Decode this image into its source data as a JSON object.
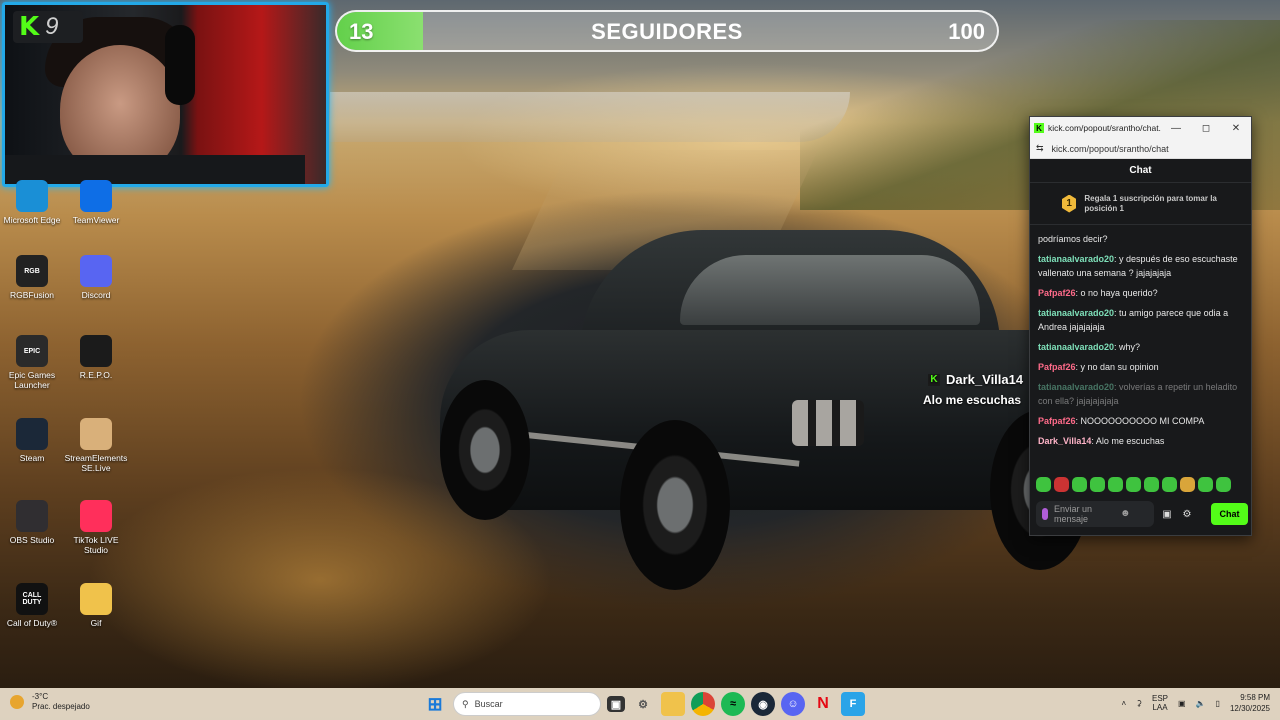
{
  "webcam": {
    "logo_letter": "K",
    "logo_number": "9"
  },
  "follower_goal": {
    "current": "13",
    "title": "SEGUIDORES",
    "goal": "100",
    "progress_fraction": 0.13
  },
  "desktop_icons": [
    {
      "label": "Microsoft Edge",
      "icon": "edge-icon",
      "color": "#1a8fd6"
    },
    {
      "label": "TeamViewer",
      "icon": "teamviewer-icon",
      "color": "#0e6ee6"
    },
    {
      "label": "RGBFusion",
      "icon": "rgbfusion-icon",
      "color": "#222222",
      "glyph": "RGB"
    },
    {
      "label": "Discord",
      "icon": "discord-icon",
      "color": "#5865f2"
    },
    {
      "label": "Epic Games Launcher",
      "icon": "epic-games-icon",
      "color": "#2a2a2a",
      "glyph": "EPIC"
    },
    {
      "label": "R.E.P.O.",
      "icon": "repo-icon",
      "color": "#1b1b1b"
    },
    {
      "label": "Steam",
      "icon": "steam-icon",
      "color": "#1b2838"
    },
    {
      "label": "StreamElements SE.Live",
      "icon": "streamelements-icon",
      "color": "#d9b07a"
    },
    {
      "label": "OBS Studio",
      "icon": "obs-icon",
      "color": "#302e31"
    },
    {
      "label": "TikTok LIVE Studio",
      "icon": "tiktok-icon",
      "color": "#ff2f5b"
    },
    {
      "label": "Call of Duty®",
      "icon": "call-of-duty-icon",
      "color": "#111111",
      "glyph": "CALL DUTY"
    },
    {
      "label": "Gif",
      "icon": "folder-icon",
      "color": "#f0c24b"
    }
  ],
  "overlay": {
    "badge": "K",
    "username": "Dark_Villa14",
    "message": "Alo me escuchas"
  },
  "chat_window": {
    "tab_title": "kick.com/popout/srantho/chat...",
    "url": "kick.com/popout/srantho/chat",
    "header": "Chat",
    "sub_rank": "1",
    "sub_text": "Regala 1 suscripción para tomar la posición 1",
    "messages": [
      {
        "user": "",
        "text": "podríamos decir?",
        "color": "#7ee0b9",
        "dim": false
      },
      {
        "user": "tatianaalvarado20",
        "text": ": y después de eso escuchaste vallenato una semana ? jajajajaja",
        "color": "#7ee0b9",
        "dim": false
      },
      {
        "user": "Pafpaf26",
        "text": ": o no haya querido?",
        "color": "#ff6b8a",
        "dim": false
      },
      {
        "user": "tatianaalvarado20",
        "text": ": tu amigo parece que odia a Andrea jajajajaja",
        "color": "#7ee0b9",
        "dim": false
      },
      {
        "user": "tatianaalvarado20",
        "text": ": why?",
        "color": "#7ee0b9",
        "dim": false
      },
      {
        "user": "Pafpaf26",
        "text": ": y no dan su opinion",
        "color": "#ff6b8a",
        "dim": false
      },
      {
        "user": "tatianaalvarado20",
        "text": ": volverías a repetir un heladito con ella? jajajajajaja",
        "color": "#7ee0b9",
        "dim": true
      },
      {
        "user": "Pafpaf26",
        "text": ": NOOOOOOOOOO MI COMPA",
        "color": "#ff6b8a",
        "dim": false
      },
      {
        "user": "Dark_Villa14",
        "text": ": Alo me escuchas",
        "color": "#ffb4c8",
        "dim": false
      }
    ],
    "input_placeholder": "Enviar un mensaje",
    "send_label": "Chat"
  },
  "taskbar": {
    "weather_temp": "-3°C",
    "weather_desc": "Prac. despejado",
    "search_placeholder": "Buscar",
    "lang_primary": "ESP",
    "lang_secondary": "LAA",
    "time": "9:58 PM",
    "date": "12/30/2025"
  },
  "colors": {
    "kick_green": "#53fc18",
    "webcam_border": "#23a9e8"
  }
}
